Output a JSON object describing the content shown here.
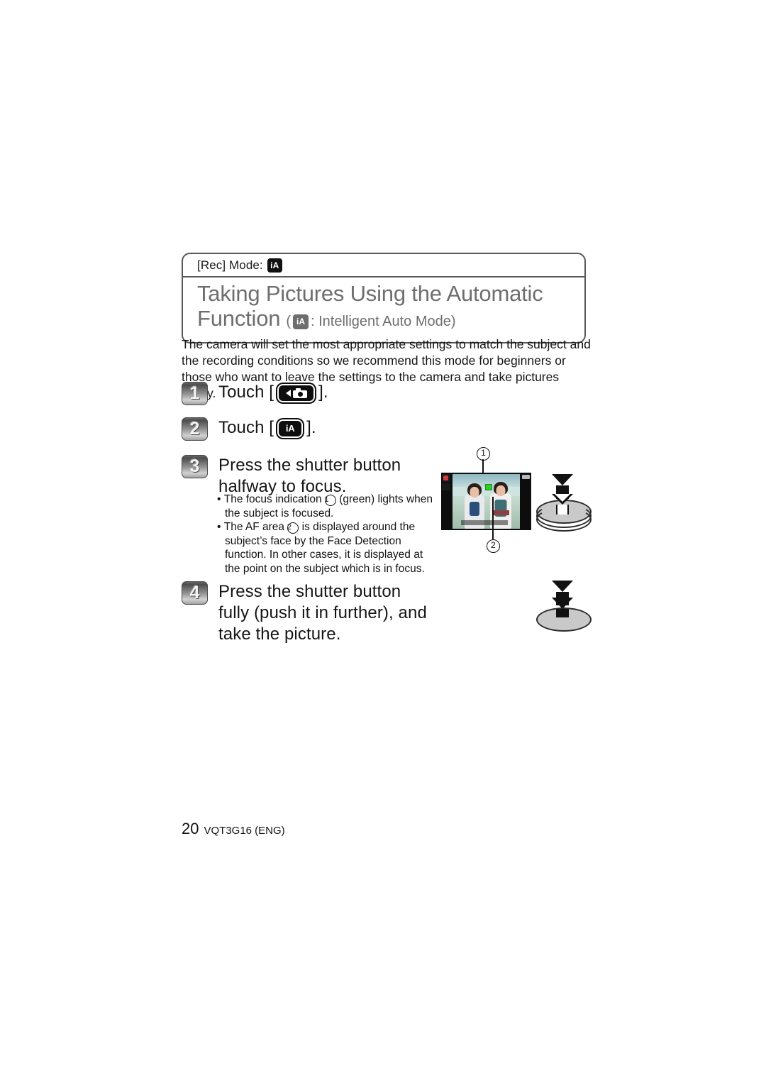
{
  "header": {
    "rec_mode_label": "[Rec] Mode:",
    "rec_mode_icon_text": "iA",
    "title_line1": "Taking Pictures Using the Automatic",
    "title_line2": "Function",
    "title_paren_open": "(",
    "title_icon_text": "iA",
    "title_sub": ": Intelligent Auto Mode)"
  },
  "intro": {
    "text": "The camera will set the most appropriate settings to match the subject and the recording conditions so we recommend this mode for beginners or those who want to leave the settings to the camera and take pictures easily."
  },
  "steps": [
    {
      "number": "1",
      "prefix": "Touch [",
      "icon": "playback-record-camera-icon",
      "icon_text": "",
      "suffix": "].",
      "full_text": "Touch [camera icon]."
    },
    {
      "number": "2",
      "prefix": "Touch [",
      "icon": "intelligent-auto-icon",
      "icon_text": "iA",
      "suffix": "].",
      "full_text": "Touch [iA]."
    },
    {
      "number": "3",
      "prefix": "",
      "icon": "",
      "icon_text": "",
      "suffix": "",
      "full_text": "Press the shutter button halfway to focus."
    },
    {
      "number": "4",
      "prefix": "",
      "icon": "",
      "icon_text": "",
      "suffix": "",
      "full_text": "Press the shutter button fully (push it in further), and take the picture."
    }
  ],
  "bullets": [
    {
      "pre": "The focus indication ",
      "marker": "1",
      "post": " (green) lights when the subject is focused."
    },
    {
      "pre": "The AF area ",
      "marker": "2",
      "post": " is displayed around the subject’s face by the Face Detection function. In other cases, it is displayed at the point on the subject which is in focus."
    }
  ],
  "illustration": {
    "callout_1": "1",
    "callout_2": "2",
    "lcd_top_osd": "",
    "focus_indicator_color": "#2ecc2e"
  },
  "footer": {
    "page_number": "20",
    "doc_code": "VQT3G16 (ENG)"
  },
  "colors": {
    "title_gray": "#6e6e6e",
    "border_gray": "#595959",
    "text_black": "#131313",
    "focus_green": "#2ecc2e"
  }
}
